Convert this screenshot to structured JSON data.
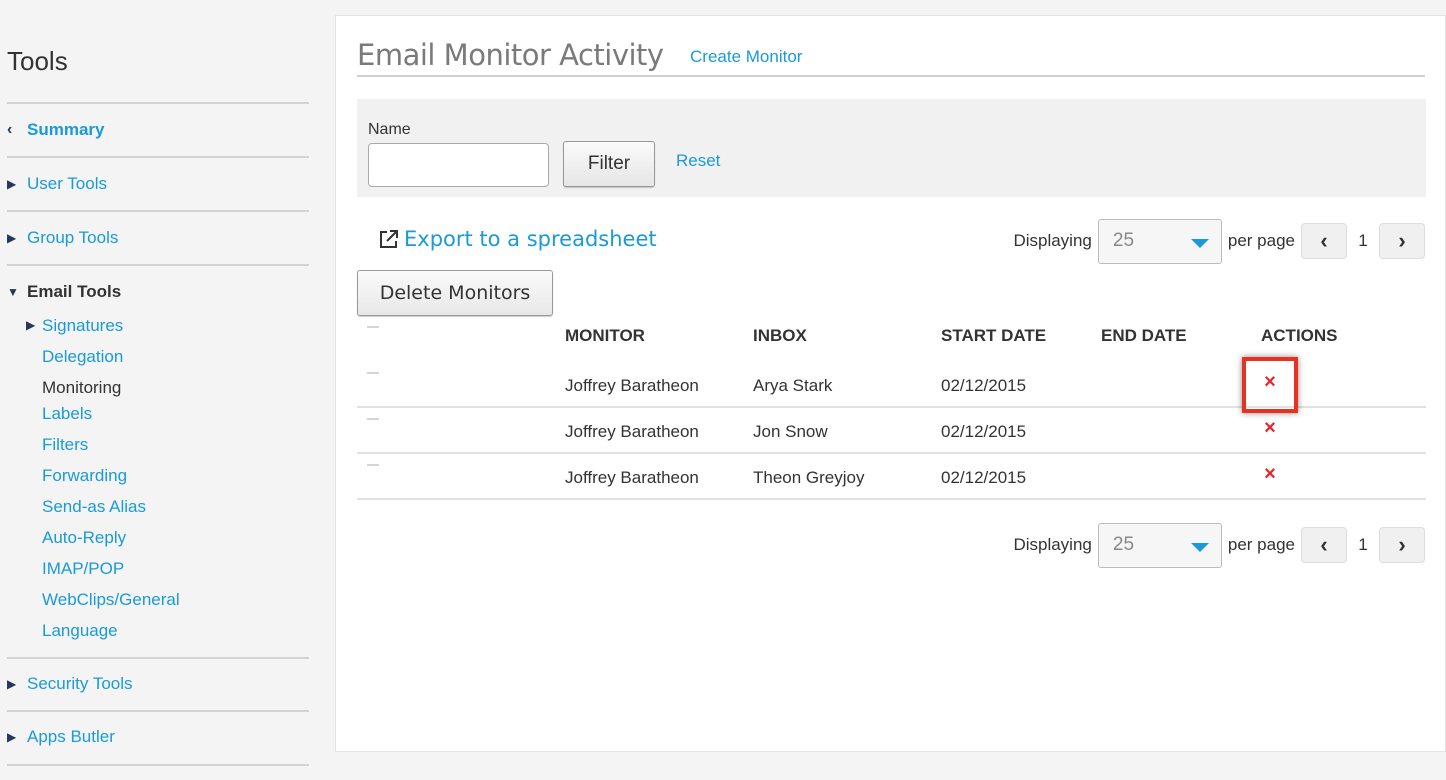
{
  "sidebar": {
    "title": "Tools",
    "items": [
      {
        "label": "Summary"
      },
      {
        "label": "User Tools"
      },
      {
        "label": "Group Tools"
      },
      {
        "label": "Email Tools"
      },
      {
        "label": "Security Tools"
      },
      {
        "label": "Apps Butler"
      }
    ],
    "email_tools_sub": [
      {
        "label": "Signatures"
      },
      {
        "label": "Delegation"
      },
      {
        "label": "Monitoring"
      },
      {
        "label": "Labels"
      },
      {
        "label": "Filters"
      },
      {
        "label": "Forwarding"
      },
      {
        "label": "Send-as Alias"
      },
      {
        "label": "Auto-Reply"
      },
      {
        "label": "IMAP/POP"
      },
      {
        "label": "WebClips/General"
      },
      {
        "label": "Language"
      }
    ]
  },
  "main": {
    "title": "Email Monitor Activity",
    "create_link": "Create Monitor",
    "filter": {
      "name_label": "Name",
      "name_value": "",
      "filter_button": "Filter",
      "reset_link": "Reset"
    },
    "export_link": "Export to a spreadsheet",
    "delete_button": "Delete Monitors",
    "pager": {
      "displaying_label": "Displaying",
      "per_page_value": "25",
      "per_page_label": "per page",
      "page_number": "1"
    },
    "table": {
      "headers": [
        "MONITOR",
        "INBOX",
        "START DATE",
        "END DATE",
        "ACTIONS"
      ],
      "rows": [
        {
          "monitor": "Joffrey Baratheon",
          "inbox": "Arya Stark",
          "start_date": "02/12/2015",
          "end_date": "",
          "action": "×"
        },
        {
          "monitor": "Joffrey Baratheon",
          "inbox": "Jon Snow",
          "start_date": "02/12/2015",
          "end_date": "",
          "action": "×"
        },
        {
          "monitor": "Joffrey Baratheon",
          "inbox": "Theon Greyjoy",
          "start_date": "02/12/2015",
          "end_date": "",
          "action": "×"
        }
      ]
    }
  },
  "colors": {
    "link": "#1a9ad8",
    "delete_icon": "#e8232a",
    "highlight": "#e8311e"
  },
  "icons": {
    "collapse": "chevron-left-icon",
    "expand": "triangle-right-icon",
    "expanded": "triangle-down-icon",
    "export": "external-link-icon",
    "delete": "close-x-icon"
  }
}
